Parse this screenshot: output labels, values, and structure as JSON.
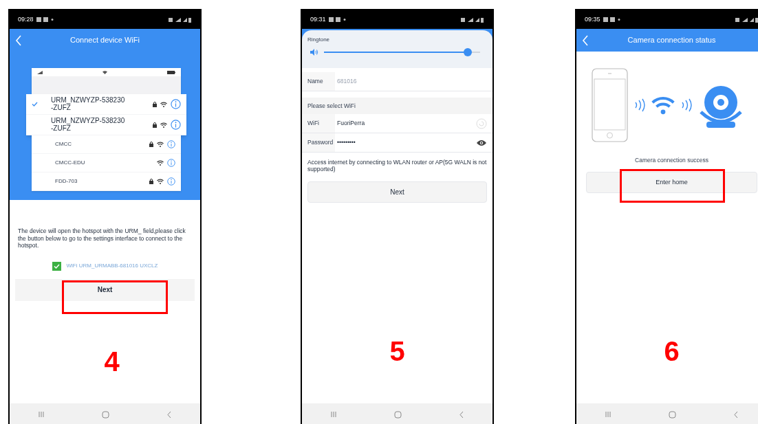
{
  "screens": [
    {
      "kind": "hotspot",
      "status_time": "09:28",
      "title": "Connect device WiFi",
      "networks": [
        {
          "lines": [
            "URM_NZWYZP-538230",
            "-ZUFZ"
          ],
          "selected": true,
          "locked": true,
          "magnified": true
        },
        {
          "lines": [
            "URM_NZWYZP-538230",
            "-ZUFZ"
          ],
          "selected": false,
          "locked": true,
          "magnified": true
        },
        {
          "lines": [
            "CMCC"
          ],
          "selected": false,
          "locked": true,
          "magnified": false
        },
        {
          "lines": [
            "CMCC-EDU"
          ],
          "selected": false,
          "locked": false,
          "magnified": false
        },
        {
          "lines": [
            "FDD-703"
          ],
          "selected": false,
          "locked": true,
          "magnified": false
        }
      ],
      "instructions": "The device will open the hotspot with the URM_ field,please click the button below to go to the settings interface to connect to the hotspot.",
      "hotspot": {
        "label": "WiFi URM_URMABB-681016 UXCLZ",
        "checked": true
      },
      "button": {
        "label": "Next",
        "annotated": true
      },
      "step": "4"
    },
    {
      "kind": "form",
      "status_time": "09:31",
      "volume": {
        "label": "Ringtone",
        "level": 0.92
      },
      "fields": [
        {
          "kind": "text",
          "label": "Name",
          "value": "681016"
        }
      ],
      "section": "Please select WiFi",
      "wifi_fields": [
        {
          "kind": "wifi",
          "label": "WiFi",
          "value": "FuoriPerra"
        },
        {
          "kind": "password",
          "label": "Password",
          "value": "•••••••••"
        }
      ],
      "note": "Access internet by connecting to WLAN router or AP(5G WALN is not supported)",
      "button": {
        "label": "Next",
        "annotated": false
      },
      "step": "5"
    },
    {
      "kind": "status",
      "status_time": "09:35",
      "title": "Camera connection status",
      "message": "Camera connection success",
      "button": {
        "label": "Enter home",
        "annotated": true
      },
      "step": "6"
    }
  ]
}
